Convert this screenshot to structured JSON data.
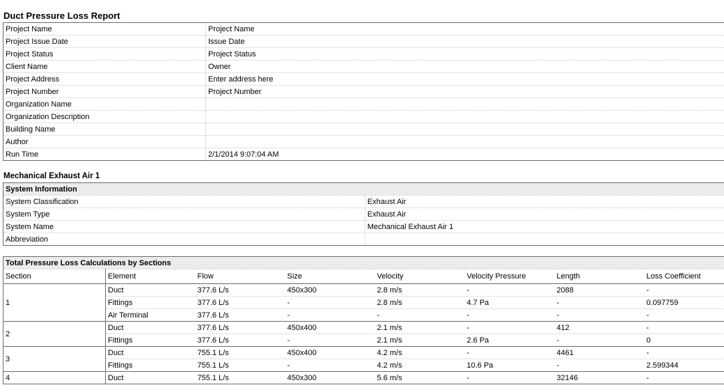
{
  "report": {
    "title": "Duct Pressure Loss Report",
    "project_info": [
      {
        "label": "Project Name",
        "value": "Project Name"
      },
      {
        "label": "Project Issue Date",
        "value": "Issue Date"
      },
      {
        "label": "Project Status",
        "value": "Project Status"
      },
      {
        "label": "Client Name",
        "value": "Owner"
      },
      {
        "label": "Project Address",
        "value": "Enter address here"
      },
      {
        "label": "Project Number",
        "value": "Project Number"
      },
      {
        "label": "Organization Name",
        "value": ""
      },
      {
        "label": "Organization Description",
        "value": ""
      },
      {
        "label": "Building Name",
        "value": ""
      },
      {
        "label": "Author",
        "value": ""
      },
      {
        "label": "Run Time",
        "value": "2/1/2014 9:07:04 AM"
      }
    ]
  },
  "system": {
    "title": "Mechanical Exhaust Air 1",
    "section_header": "System Information",
    "info": [
      {
        "label": "System Classification",
        "value": "Exhaust Air"
      },
      {
        "label": "System Type",
        "value": "Exhaust Air"
      },
      {
        "label": "System Name",
        "value": "Mechanical Exhaust Air 1"
      },
      {
        "label": "Abbreviation",
        "value": ""
      }
    ]
  },
  "calc": {
    "header": "Total Pressure Loss Calculations by Sections",
    "columns": [
      "Section",
      "Element",
      "Flow",
      "Size",
      "Velocity",
      "Velocity Pressure",
      "Length",
      "Loss Coefficient"
    ],
    "sections": [
      {
        "section": "1",
        "rows": [
          {
            "element": "Duct",
            "flow": "377.6 L/s",
            "size": "450x300",
            "velocity": "2.8 m/s",
            "vp": "-",
            "length": "2088",
            "loss": "-"
          },
          {
            "element": "Fittings",
            "flow": "377.6 L/s",
            "size": "-",
            "velocity": "2.8 m/s",
            "vp": "4.7 Pa",
            "length": "-",
            "loss": "0.097759"
          },
          {
            "element": "Air Terminal",
            "flow": "377.6 L/s",
            "size": "-",
            "velocity": "-",
            "vp": "-",
            "length": "-",
            "loss": "-"
          }
        ]
      },
      {
        "section": "2",
        "rows": [
          {
            "element": "Duct",
            "flow": "377.6 L/s",
            "size": "450x400",
            "velocity": "2.1 m/s",
            "vp": "-",
            "length": "412",
            "loss": "-"
          },
          {
            "element": "Fittings",
            "flow": "377.6 L/s",
            "size": "-",
            "velocity": "2.1 m/s",
            "vp": "2.6 Pa",
            "length": "-",
            "loss": "0"
          }
        ]
      },
      {
        "section": "3",
        "rows": [
          {
            "element": "Duct",
            "flow": "755.1 L/s",
            "size": "450x400",
            "velocity": "4.2 m/s",
            "vp": "-",
            "length": "4461",
            "loss": "-"
          },
          {
            "element": "Fittings",
            "flow": "755.1 L/s",
            "size": "-",
            "velocity": "4.2 m/s",
            "vp": "10.6 Pa",
            "length": "-",
            "loss": "2.599344"
          }
        ]
      },
      {
        "section": "4",
        "rows": [
          {
            "element": "Duct",
            "flow": "755.1 L/s",
            "size": "450x300",
            "velocity": "5.6 m/s",
            "vp": "-",
            "length": "32146",
            "loss": "-"
          }
        ]
      }
    ]
  }
}
